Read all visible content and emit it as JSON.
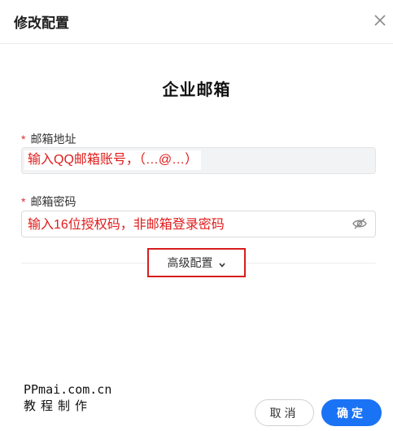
{
  "dialog": {
    "title": "修改配置"
  },
  "section": {
    "title": "企业邮箱"
  },
  "fields": {
    "email": {
      "required_mark": "*",
      "label": "邮箱地址",
      "overlay_text": "输入QQ邮箱账号，（…@…）"
    },
    "password": {
      "required_mark": "*",
      "label": "邮箱密码",
      "overlay_text": "输入16位授权码，非邮箱登录密码"
    }
  },
  "advanced": {
    "label": "高级配置"
  },
  "watermark": {
    "line1": "PPmai.com.cn",
    "line2": "教程制作"
  },
  "footer": {
    "cancel_label": "取消",
    "ok_label": "确定"
  },
  "colors": {
    "primary": "#1a73f5",
    "annotation_red": "#e01b1b",
    "required_red": "#e03131"
  }
}
